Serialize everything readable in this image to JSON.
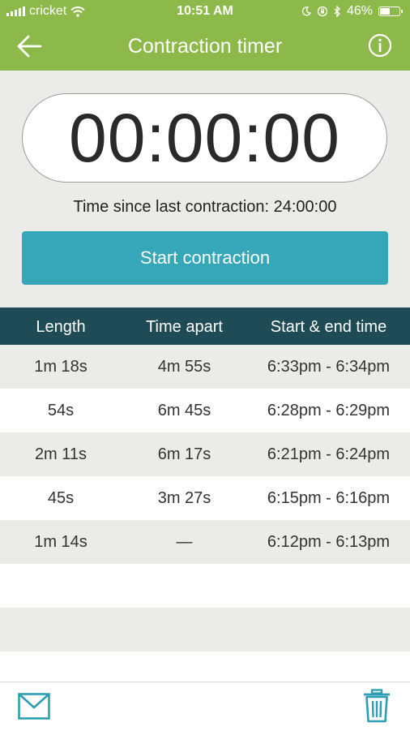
{
  "status_bar": {
    "carrier": "cricket",
    "time": "10:51 AM",
    "battery": "46%",
    "battery_level": 0.46
  },
  "header": {
    "title": "Contraction timer"
  },
  "timer": {
    "display": "00:00:00",
    "since_label": "Time since last contraction: 24:00:00"
  },
  "start_button": {
    "label": "Start contraction"
  },
  "table": {
    "columns": [
      "Length",
      "Time apart",
      "Start & end time"
    ],
    "rows": [
      {
        "length": "1m 18s",
        "apart": "4m 55s",
        "times": "6:33pm - 6:34pm"
      },
      {
        "length": "54s",
        "apart": "6m 45s",
        "times": "6:28pm - 6:29pm"
      },
      {
        "length": "2m 11s",
        "apart": "6m 17s",
        "times": "6:21pm - 6:24pm"
      },
      {
        "length": "45s",
        "apart": "3m 27s",
        "times": "6:15pm - 6:16pm"
      },
      {
        "length": "1m 14s",
        "apart": "—",
        "times": "6:12pm - 6:13pm"
      }
    ]
  },
  "colors": {
    "header_green": "#8db84a",
    "button_teal": "#36a7b8",
    "table_head": "#1e4b55",
    "icon_teal": "#2e9fb2"
  },
  "icons": {
    "back": "back-arrow-icon",
    "info": "info-icon",
    "mail": "mail-icon",
    "trash": "trash-icon"
  }
}
